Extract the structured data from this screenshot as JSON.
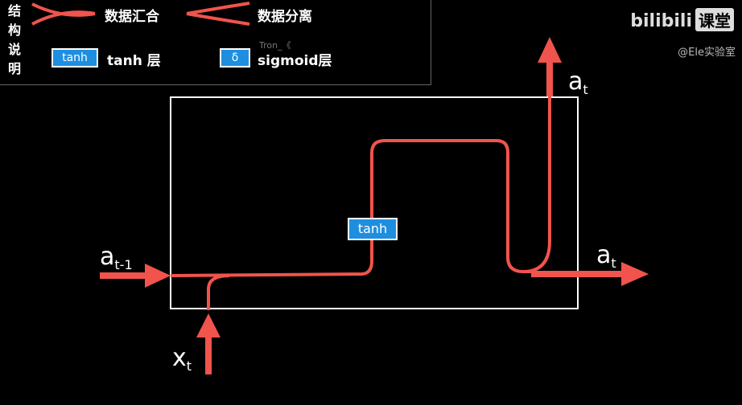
{
  "legend": {
    "title_chars": [
      "结",
      "构",
      "说",
      "明"
    ],
    "merge_label": "数据汇合",
    "split_label": "数据分离",
    "tanh_box": "tanh",
    "tanh_label": "tanh 层",
    "sigmoid_box": "δ",
    "sigmoid_label": "sigmoid层"
  },
  "overlay_text": "Tron_《",
  "brand": {
    "name": "bilibili",
    "tag": "课堂",
    "sub": "@Ele实验室"
  },
  "diagram": {
    "tanh_label": "tanh",
    "input_prev": {
      "base": "a",
      "sub": "t-1"
    },
    "input_x": {
      "base": "x",
      "sub": "t"
    },
    "output_up": {
      "base": "a",
      "sub": "t"
    },
    "output_right": {
      "base": "a",
      "sub": "t"
    }
  },
  "colors": {
    "flow": "#f0544c",
    "box_fill": "#1e8fe0",
    "frame": "#ffffff"
  }
}
